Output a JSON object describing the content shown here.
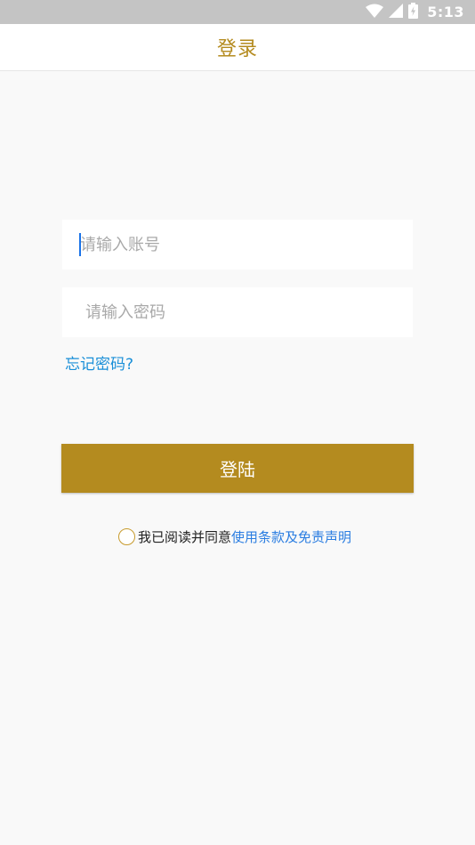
{
  "status_bar": {
    "time": "5:13",
    "icons": [
      "wifi-icon",
      "cellular-signal-icon",
      "battery-charging-icon"
    ]
  },
  "header": {
    "title": "登录"
  },
  "form": {
    "account_placeholder": "请输入账号",
    "password_placeholder": "请输入密码",
    "forgot_password": "忘记密码?",
    "login_button": "登陆"
  },
  "agreement": {
    "prefix": "我已阅读并同意",
    "terms_link": "使用条款及免责声明"
  },
  "colors": {
    "accent": "#b48b1f",
    "link": "#1a8fd8",
    "terms_link": "#2a7de1",
    "status_bar": "#c4c4c4",
    "background": "#f9f9f9"
  }
}
